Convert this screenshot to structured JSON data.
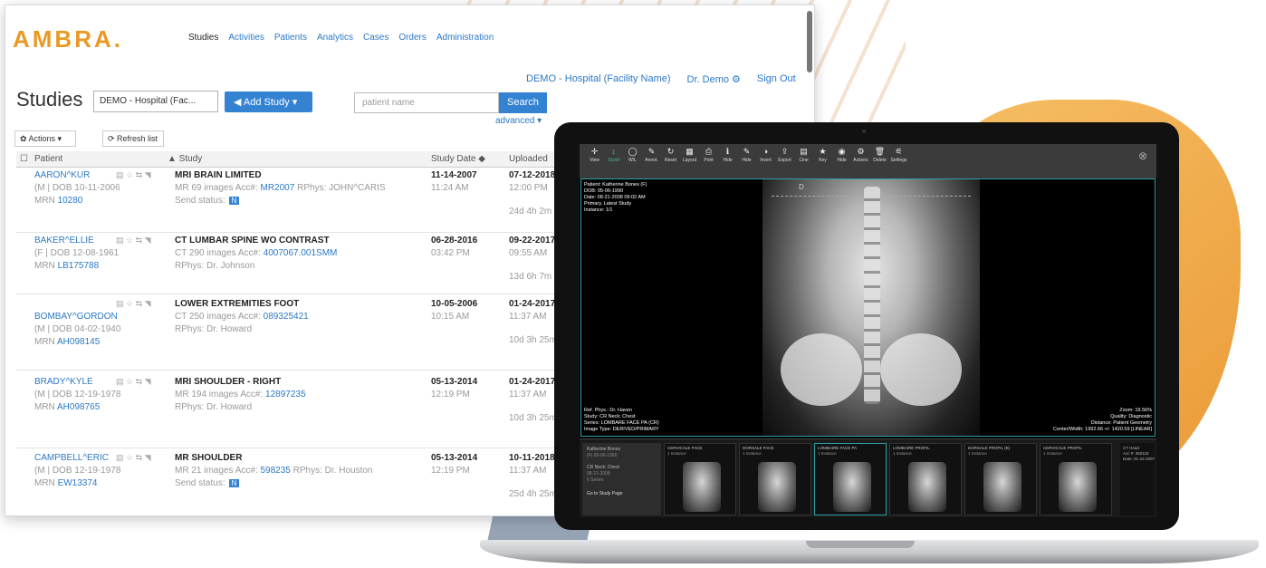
{
  "brand": {
    "logo": "AMBRA."
  },
  "nav": [
    "Studies",
    "Activities",
    "Patients",
    "Analytics",
    "Cases",
    "Orders",
    "Administration"
  ],
  "topbar": {
    "facility": "DEMO - Hospital (Facility Name)",
    "user": "Dr. Demo ⚙",
    "signout": "Sign Out"
  },
  "toolbar": {
    "title": "Studies",
    "facility_select": "DEMO - Hospital (Fac...",
    "add_study": "◀ Add Study ▾",
    "search_placeholder": "patient name",
    "search": "Search",
    "advanced": "advanced ▾",
    "actions": "✿ Actions ▾",
    "refresh": "⟳ Refresh list"
  },
  "table": {
    "headers": {
      "patient": "Patient",
      "study": "▲ Study",
      "study_date": "Study Date ◆",
      "uploaded": "Uploaded"
    },
    "rows": [
      {
        "name": "AARON^KUR",
        "dob": "(M | DOB 10-11-2006",
        "mrn_label": "MRN",
        "mrn": "10280",
        "icons": "▤ ☆ ⇆ ◥",
        "study": "MRI BRAIN LIMITED",
        "modality": "MR 69 images Acc#:",
        "acc": "MR2007",
        "rphys": "RPhys: JOHN^CARIS",
        "line3": "Send status:",
        "badge": "N",
        "study_date": "11-14-2007",
        "study_time": "11:24 AM",
        "up_date": "07-12-2018",
        "up_time": "12:00 PM",
        "duration": "24d 4h 2m"
      },
      {
        "name": "BAKER^ELLIE",
        "dob": "(F | DOB 12-08-1961",
        "mrn_label": "MRN",
        "mrn": "LB175788",
        "icons": "▤ ☆ ⇆ ◥",
        "study": "CT LUMBAR SPINE WO CONTRAST",
        "modality": "CT 290 images Acc#:",
        "acc": "4007067.001SMM",
        "rphys": "",
        "line3": "RPhys: Dr. Johnson",
        "badge": "",
        "study_date": "06-28-2016",
        "study_time": "03:42 PM",
        "up_date": "09-22-2017",
        "up_time": "09:55 AM",
        "duration": "13d 6h 7m"
      },
      {
        "name": "BOMBAY^GORDON",
        "dob": "(M | DOB 04-02-1940",
        "mrn_label": "MRN",
        "mrn": "AH098145",
        "icons": "▤ ☆ ⇆ ◥",
        "study": "LOWER EXTREMITIES FOOT",
        "modality": "CT 250 images Acc#:",
        "acc": "089325421",
        "rphys": "",
        "line3": "RPhys: Dr. Howard",
        "badge": "",
        "study_date": "10-05-2006",
        "study_time": "10:15 AM",
        "up_date": "01-24-2017",
        "up_time": "11:37 AM",
        "duration": "10d 3h 25m"
      },
      {
        "name": "BRADY^KYLE",
        "dob": "(M | DOB 12-19-1978",
        "mrn_label": "MRN",
        "mrn": "AH098765",
        "icons": "▤ ☆ ⇆ ◥",
        "study": "MRI SHOULDER - RIGHT",
        "modality": "MR 194 images Acc#:",
        "acc": "12897235",
        "rphys": "",
        "line3": "RPhys: Dr. Howard",
        "badge": "",
        "study_date": "05-13-2014",
        "study_time": "12:19 PM",
        "up_date": "01-24-2017",
        "up_time": "11:37 AM",
        "duration": "10d 3h 25m"
      },
      {
        "name": "CAMPBELL^ERIC",
        "dob": "(M | DOB 12-19-1978",
        "mrn_label": "MRN",
        "mrn": "EW13374",
        "icons": "▤ ☆ ⇆ ◥",
        "study": "MR SHOULDER",
        "modality": "MR 21 images Acc#:",
        "acc": "598235",
        "rphys": "RPhys: Dr. Houston",
        "line3": "Send status:",
        "badge": "N",
        "study_date": "05-13-2014",
        "study_time": "12:19 PM",
        "up_date": "10-11-2018",
        "up_time": "11:37 AM",
        "duration": "25d 4h 25m"
      }
    ]
  },
  "viewer": {
    "tools": [
      {
        "icon": "✛",
        "label": "View"
      },
      {
        "icon": "↕",
        "label": "Scroll"
      },
      {
        "icon": "◯",
        "label": "W/L"
      },
      {
        "icon": "✎",
        "label": "Annot."
      },
      {
        "icon": "↻",
        "label": "Reset"
      },
      {
        "icon": "▦",
        "label": "Layout"
      },
      {
        "icon": "⎙",
        "label": "Print"
      },
      {
        "icon": "ℹ",
        "label": "Hide"
      },
      {
        "icon": "✎",
        "label": "Hide"
      },
      {
        "icon": "◑",
        "label": "Invert"
      },
      {
        "icon": "⇪",
        "label": "Export"
      },
      {
        "icon": "▤",
        "label": "Cine"
      },
      {
        "icon": "★",
        "label": "Key"
      },
      {
        "icon": "◉",
        "label": "Hide"
      },
      {
        "icon": "⚙",
        "label": "Actions"
      },
      {
        "icon": "🗑",
        "label": "Delete"
      },
      {
        "icon": "⚟",
        "label": "Settings"
      }
    ],
    "overlay_tl": "Patient: Katherine Bones (F)\nDOB: 05-06-1990\nDate: 08-21-2008 09:02 AM\nPrimary, Latest Study\nInstance: 1/1",
    "overlay_bl": "Ref. Phys.: Dr. Haven\nStudy: CR Neck; Chest\nSeries: LOMBARE FACE PA (CR)\nImage Type: DERIVED/PRIMARY",
    "overlay_br": "Zoom: 19.56%\nQuality: Diagnostic\nDistance: Patient Geometry\nCenter/Width: 1992.66 +/- 1420.59 [LINEAR]",
    "image_mark": "D",
    "info_panel": {
      "name": "Katherine Bones",
      "dob": "(F) 05-06-1990",
      "study": "CR Neck; Chest",
      "date": "08-21-2008",
      "series": "6 Series",
      "go": "Go to Study Page"
    },
    "thumbs": [
      {
        "title": "CERVICALE FACE",
        "count": "1 Instance"
      },
      {
        "title": "DORSALE FACE",
        "count": "1 Instance"
      },
      {
        "title": "LOMBAIRE FACE PA",
        "count": "1 Instance"
      },
      {
        "title": "LOMBAIRE PROFIL",
        "count": "1 Instance"
      },
      {
        "title": "DORSALE PROFIL (E)",
        "count": "1 Instance"
      },
      {
        "title": "CERVICALE PROFIL",
        "count": "1 Instance"
      }
    ],
    "right_info": "CT Head\nAcc #: 350118\nDate: 01-22-2007"
  }
}
